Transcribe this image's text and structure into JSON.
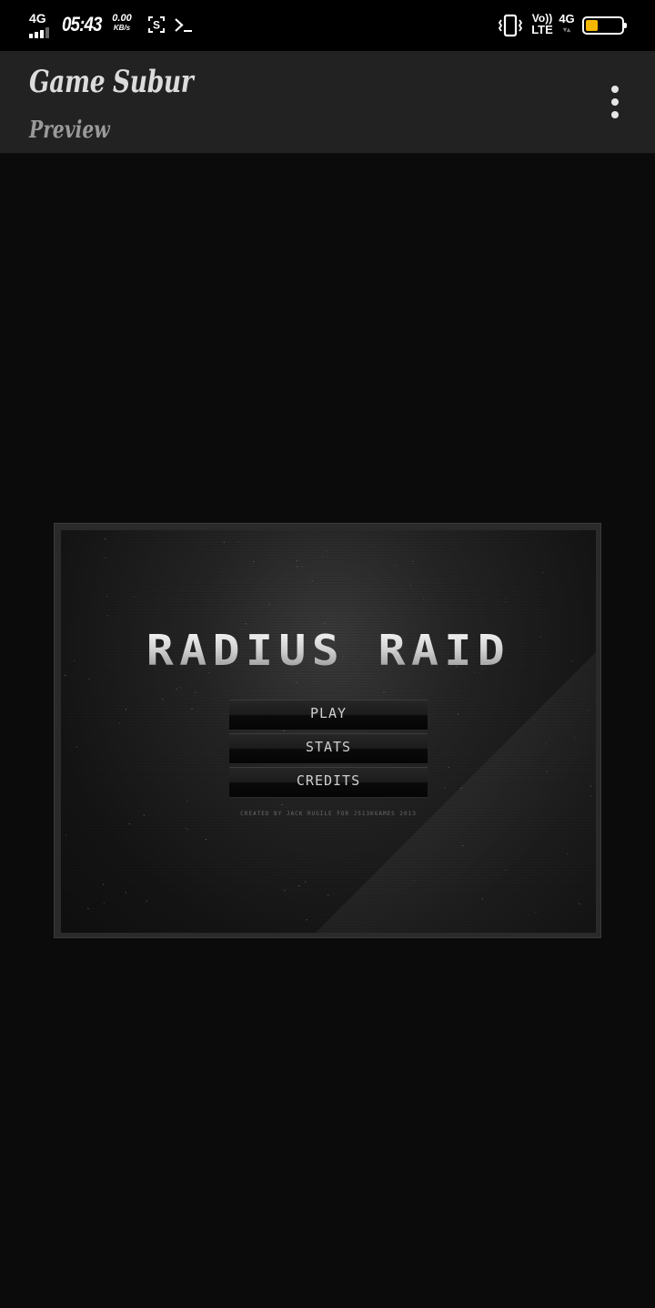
{
  "status_bar": {
    "network": "4G",
    "time": "05:43",
    "speed_value": "0.00",
    "speed_unit": "KB/s",
    "volte_top": "Vo))",
    "volte_bottom": "LTE",
    "network_right": "4G",
    "network_right_arrows": "▾▴",
    "battery_level": 0.35,
    "battery_color": "#f5b800",
    "icons": [
      "signal-icon",
      "screenshot-icon",
      "terminal-icon",
      "vibrate-icon",
      "battery-icon"
    ]
  },
  "app_bar": {
    "title": "Game Subur",
    "subtitle": "Preview",
    "menu_icon": "overflow-menu-icon"
  },
  "game": {
    "title": "RADIUS RAID",
    "menu": [
      {
        "label": "PLAY"
      },
      {
        "label": "STATS"
      },
      {
        "label": "CREDITS"
      }
    ],
    "credit": "CREATED BY JACK RUGILE FOR JS13KGAMES 2013"
  },
  "colors": {
    "background": "#0b0b0b",
    "app_bar": "#222222",
    "title_text": "#dcdcdc",
    "subtitle_text": "#9a9a9a"
  }
}
